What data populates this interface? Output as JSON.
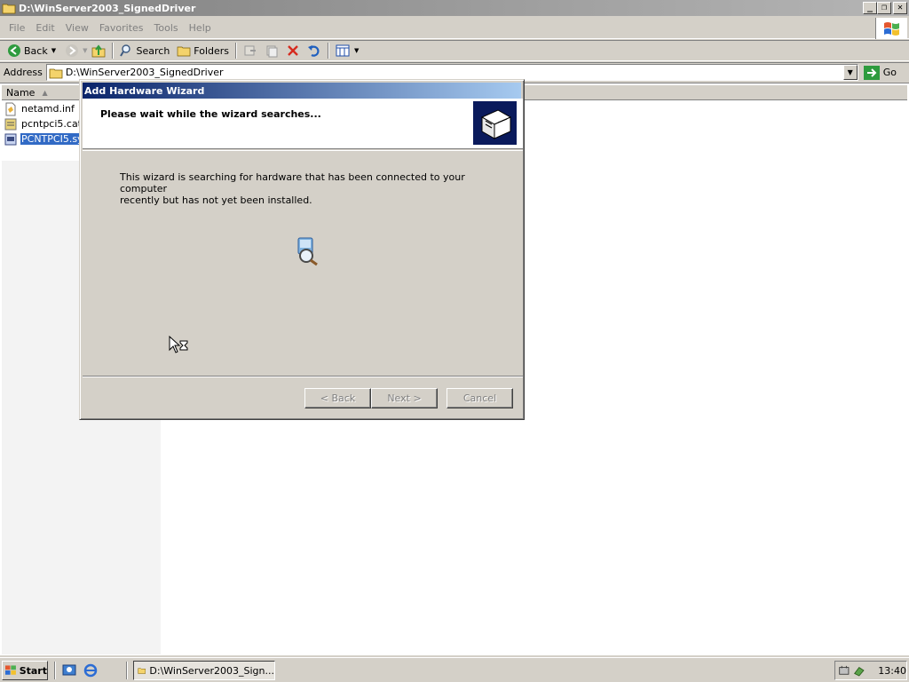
{
  "window": {
    "title": "D:\\WinServer2003_SignedDriver",
    "minimize": "_",
    "maximize": "❐",
    "close": "✕"
  },
  "menu": {
    "items": [
      "File",
      "Edit",
      "View",
      "Favorites",
      "Tools",
      "Help"
    ]
  },
  "toolbar": {
    "back_label": "Back",
    "search_label": "Search",
    "folders_label": "Folders"
  },
  "address": {
    "label": "Address",
    "value": "D:\\WinServer2003_SignedDriver",
    "go_label": "Go"
  },
  "filelist": {
    "column_name": "Name",
    "files": [
      {
        "name": "netamd.inf",
        "icon": "inf-file-icon",
        "selected": false
      },
      {
        "name": "pcntpci5.cat",
        "icon": "cat-file-icon",
        "selected": false
      },
      {
        "name": "PCNTPCI5.sy",
        "icon": "sys-file-icon",
        "selected": true
      }
    ]
  },
  "dialog": {
    "title": "Add Hardware Wizard",
    "heading": "Please wait while the wizard searches...",
    "body_line1": "This wizard is searching for hardware that has been connected to your computer",
    "body_line2": "recently but has not yet been installed.",
    "back_label": "< Back",
    "next_label": "Next >",
    "cancel_label": "Cancel"
  },
  "taskbar": {
    "start_label": "Start",
    "task_label": "D:\\WinServer2003_Sign...",
    "clock": "13:40"
  },
  "colors": {
    "dialog_title_start": "#0a246a",
    "dialog_title_end": "#a6caf0",
    "selection": "#316ac5",
    "face": "#d4d0c8"
  }
}
